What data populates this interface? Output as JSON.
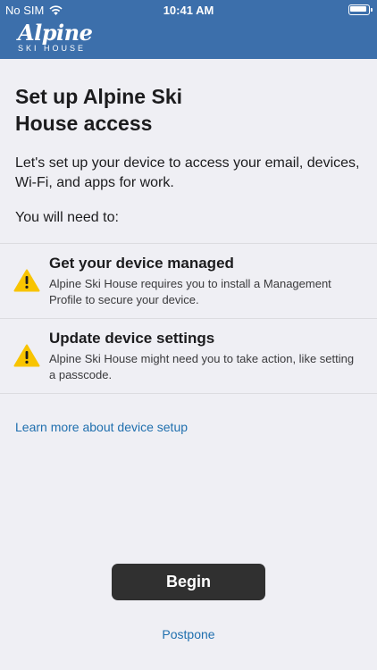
{
  "status_bar": {
    "carrier": "No SIM",
    "time": "10:41 AM"
  },
  "brand": {
    "logo_word": "Alpine",
    "logo_sub": "SKI HOUSE"
  },
  "page": {
    "title": "Set up Alpine Ski House access",
    "intro": "Let's set up your device to access your email, devices, Wi-Fi, and apps for work.",
    "need_label": "You will need to:"
  },
  "requirements": [
    {
      "title": "Get your device managed",
      "text": "Alpine Ski House requires you to install a Management Profile to secure your device.",
      "icon": "warning-icon"
    },
    {
      "title": "Update device settings",
      "text": "Alpine Ski House might need you to take action, like setting a passcode.",
      "icon": "warning-icon"
    }
  ],
  "links": {
    "learn_more": "Learn more about device setup",
    "postpone": "Postpone"
  },
  "actions": {
    "begin_label": "Begin"
  },
  "colors": {
    "brand_blue": "#3c6fab",
    "link_blue": "#1f6fae",
    "warning_yellow": "#f8c400",
    "button_dark": "#303030",
    "background": "#efeff4"
  }
}
